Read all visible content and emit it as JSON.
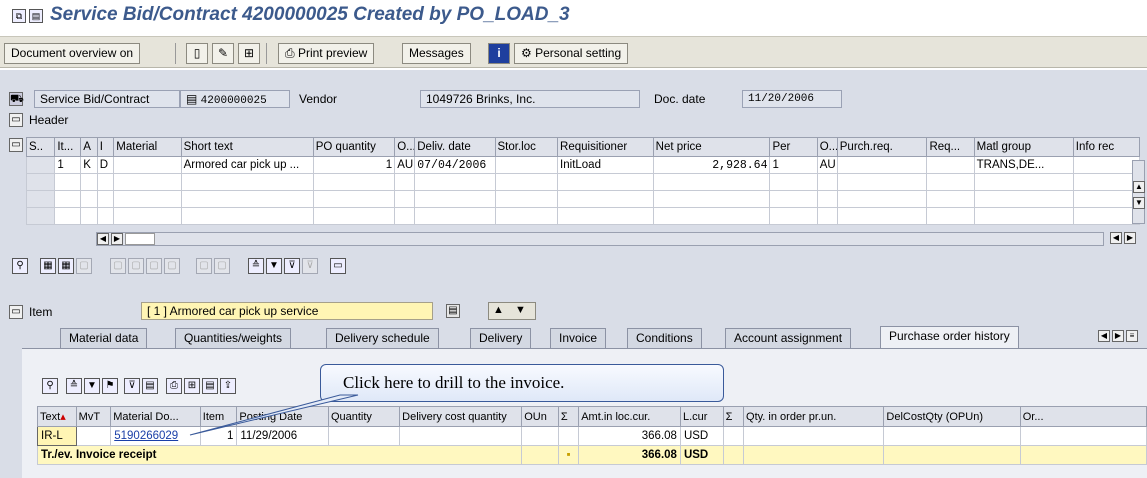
{
  "window": {
    "title": "Service Bid/Contract 4200000025 Created by PO_LOAD_3"
  },
  "toolbar": {
    "document_overview": "Document overview on",
    "print_preview": "Print preview",
    "messages": "Messages",
    "personal_setting": "Personal setting"
  },
  "header_fields": {
    "doc_type_value": "Service Bid/Contract",
    "doc_number": "4200000025",
    "vendor_label": "Vendor",
    "vendor_value": "1049726 Brinks, Inc.",
    "doc_date_label": "Doc. date",
    "doc_date_value": "11/20/2006",
    "header_label": "Header"
  },
  "item_grid": {
    "columns": [
      "S..",
      "It...",
      "A",
      "I",
      "Material",
      "Short text",
      "PO quantity",
      "O...",
      "Deliv. date",
      "Stor.loc",
      "Requisitioner",
      "Net price",
      "Per",
      "O...",
      "Purch.req.",
      "Req...",
      "Matl group",
      "Info rec"
    ],
    "rows": [
      {
        "item": "1",
        "acct": "K",
        "cat": "D",
        "material": "",
        "short_text": "Armored car pick up ...",
        "po_quantity": "1",
        "order_unit": "AU",
        "deliv_date": "07/04/2006",
        "stor_loc": "",
        "requisitioner": "InitLoad",
        "net_price": "2,928.64",
        "per": "1",
        "order_price_unit": "AU",
        "purch_req": "",
        "req": "",
        "matl_group": "TRANS,DE...",
        "info_rec": ""
      }
    ]
  },
  "item_section": {
    "label": "Item",
    "selected_item": "[ 1 ] Armored car pick up service"
  },
  "tabs": [
    {
      "label": "Material data"
    },
    {
      "label": "Quantities/weights"
    },
    {
      "label": "Delivery schedule"
    },
    {
      "label": "Delivery"
    },
    {
      "label": "Invoice"
    },
    {
      "label": "Conditions"
    },
    {
      "label": "Account assignment"
    },
    {
      "label": "Purchase order history"
    }
  ],
  "history_grid": {
    "columns": [
      "Text",
      "MvT",
      "Material Do...",
      "Item",
      "Posting Date",
      "Quantity",
      "Delivery cost quantity",
      "OUn",
      "Σ",
      "Amt.in loc.cur.",
      "L.cur",
      "Σ",
      "Qty. in order pr.un.",
      "DelCostQty (OPUn)",
      "Or..."
    ],
    "rows": [
      {
        "text": "IR-L",
        "mvt": "",
        "material_doc": "5190266029",
        "item": "1",
        "posting_date": "11/29/2006",
        "amount": "366.08",
        "currency": "USD"
      }
    ],
    "total": {
      "text": "Tr./ev. Invoice receipt",
      "marker": "▪",
      "amount": "366.08",
      "currency": "USD"
    }
  },
  "callout": {
    "text": "Click here to drill to the invoice."
  }
}
